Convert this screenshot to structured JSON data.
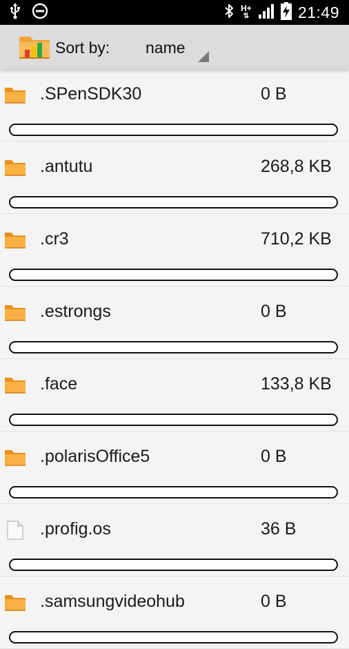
{
  "status_bar": {
    "time": "21:49",
    "network_label": "H+",
    "icons": [
      "usb-icon",
      "do-not-disturb-icon",
      "bluetooth-icon",
      "hplus-network-icon",
      "signal-icon",
      "battery-charging-icon"
    ]
  },
  "toolbar": {
    "app_icon": "folder-chart-icon",
    "sort_label": "Sort by:",
    "sort_value": "name"
  },
  "colors": {
    "folder": "#f5a623",
    "folder_dark": "#e08a10",
    "status_bar": "#000000",
    "action_bar": "#dcdcdc",
    "list_bg": "#f4f4f4"
  },
  "files": [
    {
      "name": ".SPenSDK30",
      "size": "0 B",
      "type": "folder",
      "fraction": 0
    },
    {
      "name": ".antutu",
      "size": "268,8 KB",
      "type": "folder",
      "fraction": 0
    },
    {
      "name": ".cr3",
      "size": "710,2 KB",
      "type": "folder",
      "fraction": 0
    },
    {
      "name": ".estrongs",
      "size": "0 B",
      "type": "folder",
      "fraction": 0
    },
    {
      "name": ".face",
      "size": "133,8 KB",
      "type": "folder",
      "fraction": 0
    },
    {
      "name": ".polarisOffice5",
      "size": "0 B",
      "type": "folder",
      "fraction": 0
    },
    {
      "name": ".profig.os",
      "size": "36 B",
      "type": "file",
      "fraction": 0
    },
    {
      "name": ".samsungvideohub",
      "size": "0 B",
      "type": "folder",
      "fraction": 0
    }
  ]
}
